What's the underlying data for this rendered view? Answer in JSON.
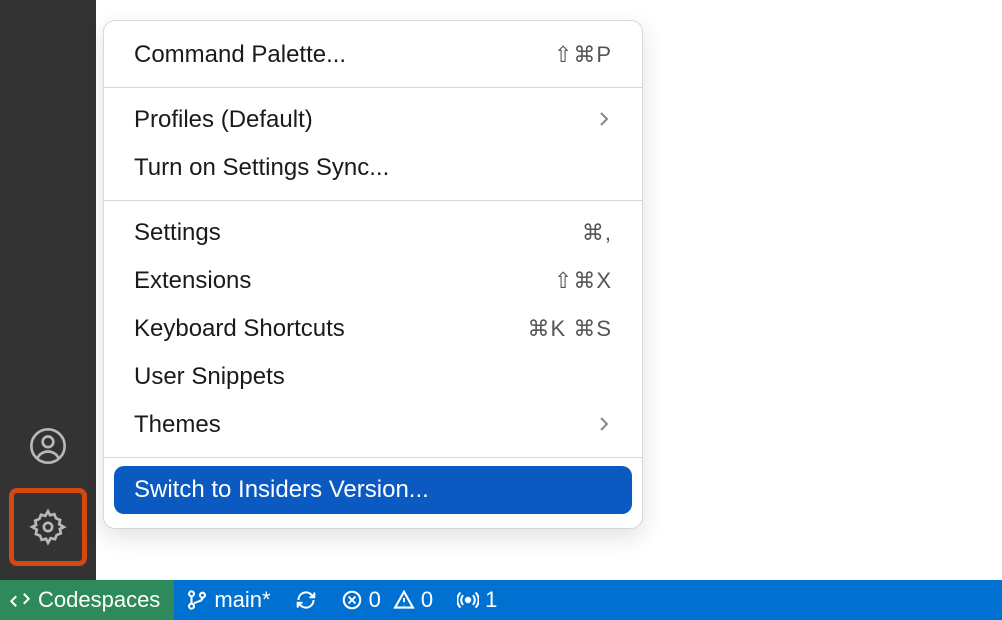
{
  "menu": {
    "items": [
      {
        "label": "Command Palette...",
        "shortcut": "⇧⌘P",
        "section": 0
      },
      {
        "label": "Profiles (Default)",
        "submenu": true,
        "section": 1
      },
      {
        "label": "Turn on Settings Sync...",
        "section": 1
      },
      {
        "label": "Settings",
        "shortcut": "⌘,",
        "section": 2
      },
      {
        "label": "Extensions",
        "shortcut": "⇧⌘X",
        "section": 2
      },
      {
        "label": "Keyboard Shortcuts",
        "shortcut": "⌘K ⌘S",
        "section": 2
      },
      {
        "label": "User Snippets",
        "section": 2
      },
      {
        "label": "Themes",
        "submenu": true,
        "section": 2
      },
      {
        "label": "Switch to Insiders Version...",
        "highlighted": true,
        "section": 3
      }
    ]
  },
  "statusBar": {
    "codespaces": "Codespaces",
    "branch": "main*",
    "errors": "0",
    "warnings": "0",
    "ports": "1"
  }
}
